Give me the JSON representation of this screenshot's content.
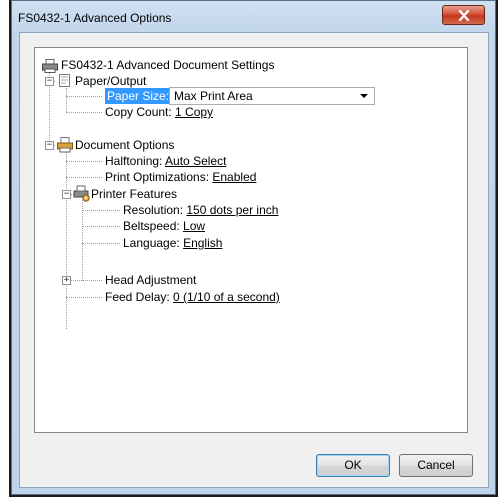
{
  "window": {
    "title": "FS0432-1 Advanced Options"
  },
  "tree": {
    "root_label": "FS0432-1 Advanced Document Settings",
    "paper_output": {
      "label": "Paper/Output",
      "paper_size_label": "Paper Size:",
      "paper_size_value": "Max Print Area",
      "copy_count_label": "Copy Count: ",
      "copy_count_value": "1 Copy"
    },
    "document_options": {
      "label": "Document Options",
      "halftoning_label": "Halftoning: ",
      "halftoning_value": "Auto Select",
      "print_opt_label": "Print Optimizations: ",
      "print_opt_value": "Enabled",
      "printer_features": {
        "label": "Printer Features",
        "resolution_label": "Resolution: ",
        "resolution_value": "150 dots per inch",
        "beltspeed_label": "Beltspeed: ",
        "beltspeed_value": "Low",
        "language_label": "Language: ",
        "language_value": "English"
      },
      "head_adjustment_label": "Head Adjustment",
      "feed_delay_label": "Feed Delay: ",
      "feed_delay_value": "0  (1/10 of a second)"
    }
  },
  "buttons": {
    "ok": "OK",
    "cancel": "Cancel"
  },
  "icons": {
    "root": "printer-icon",
    "paper_output": "paper-icon",
    "document_options": "document-printer-icon",
    "printer_features": "printer-features-icon",
    "close": "close-icon"
  }
}
